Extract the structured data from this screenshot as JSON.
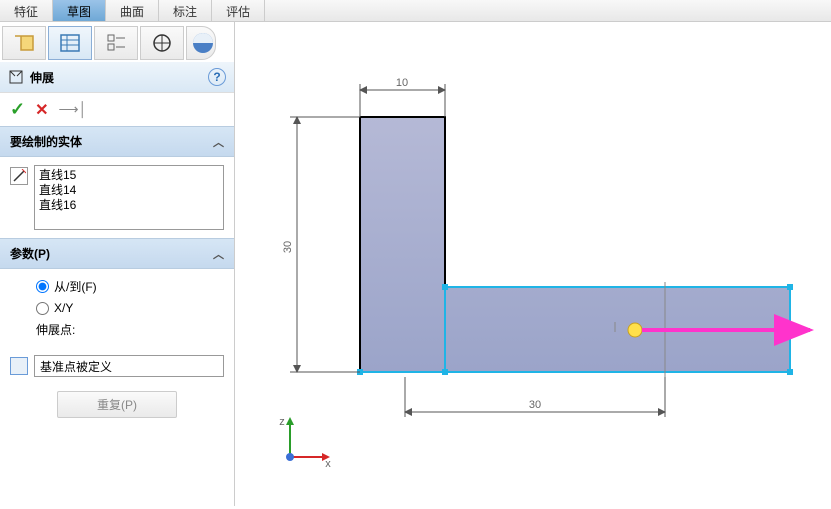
{
  "topTabs": [
    "特征",
    "草图",
    "曲面",
    "标注",
    "评估"
  ],
  "activeTabIndex": 1,
  "feature": {
    "title": "伸展"
  },
  "sections": {
    "entities": {
      "title": "要绘制的实体",
      "items": [
        "直线15",
        "直线14",
        "直线16"
      ]
    },
    "params": {
      "title": "参数(P)",
      "radios": [
        {
          "label": "从/到(F)",
          "checked": true
        },
        {
          "label": "X/Y",
          "checked": false
        }
      ],
      "extendPointLabel": "伸展点:",
      "extendValue": "基准点被定义"
    }
  },
  "repeatBtn": "重复(P)",
  "triad": {
    "x": "x",
    "y": "",
    "z": "z"
  },
  "dims": {
    "top": "10",
    "left": "30",
    "bottom": "30"
  }
}
